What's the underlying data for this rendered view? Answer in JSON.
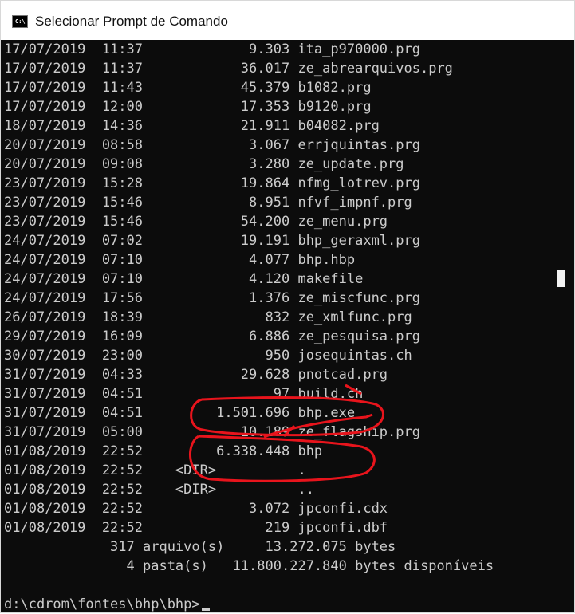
{
  "window": {
    "title": "Selecionar Prompt de Comando",
    "icon": "console-icon"
  },
  "console": {
    "lines": [
      "17/07/2019  11:37             9.303 ita_p970000.prg",
      "17/07/2019  11:37            36.017 ze_abrearquivos.prg",
      "17/07/2019  11:43            45.379 b1082.prg",
      "17/07/2019  12:00            17.353 b9120.prg",
      "18/07/2019  14:36            21.911 b04082.prg",
      "20/07/2019  08:58             3.067 errjquintas.prg",
      "20/07/2019  09:08             3.280 ze_update.prg",
      "23/07/2019  15:28            19.864 nfmg_lotrev.prg",
      "23/07/2019  15:46             8.951 nfvf_impnf.prg",
      "23/07/2019  15:46            54.200 ze_menu.prg",
      "24/07/2019  07:02            19.191 bhp_geraxml.prg",
      "24/07/2019  07:10             4.077 bhp.hbp",
      "24/07/2019  07:10             4.120 makefile",
      "24/07/2019  17:56             1.376 ze_miscfunc.prg",
      "26/07/2019  18:39               832 ze_xmlfunc.prg",
      "29/07/2019  16:09             6.886 ze_pesquisa.prg",
      "30/07/2019  23:00               950 josequintas.ch",
      "31/07/2019  04:33            29.628 pnotcad.prg",
      "31/07/2019  04:51                97 build.ch",
      "31/07/2019  04:51         1.501.696 bhp.exe",
      "31/07/2019  05:00            10.189 ze_flagship.prg",
      "01/08/2019  22:52         6.338.448 bhp",
      "01/08/2019  22:52    <DIR>          .",
      "01/08/2019  22:52    <DIR>          ..",
      "01/08/2019  22:52             3.072 jpconfi.cdx",
      "01/08/2019  22:52               219 jpconfi.dbf",
      "             317 arquivo(s)     13.272.075 bytes",
      "               4 pasta(s)   11.800.227.840 bytes disponíveis",
      ""
    ],
    "prompt": "d:\\cdrom\\fontes\\bhp\\bhp>"
  },
  "colors": {
    "console_bg": "#0c0c0c",
    "console_text": "#cccccc",
    "annotation": "#e8141c"
  }
}
